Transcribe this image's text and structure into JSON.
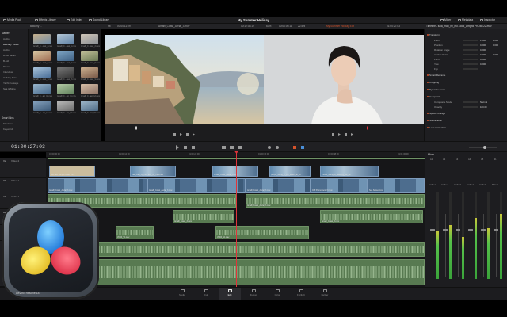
{
  "app": {
    "title": "My Summer Holiday",
    "brand": "DaVinci Resolve 18"
  },
  "topbar": {
    "left": [
      "Media Pool",
      "Effects Library",
      "Edit Index",
      "Sound Library"
    ],
    "right": [
      "Mixer",
      "Metadata",
      "Inspector"
    ]
  },
  "subbar": {
    "bin": "Balcony ...",
    "fit": "Fit",
    "tc_left": "00:00:11:09",
    "clip_name": "Amalfi_Coast_Aerial_3.mov",
    "tc_mid": "00:17:08:12",
    "zoom": "63%",
    "tc_mid2": "00:00:06:11",
    "pct": "22.5%",
    "timeline_name": "My Summer Holiday Edit",
    "tc_right": "01:00:27:03",
    "timeline_label": "Timeline - luka_mari_ny_mo...lock_Amgrid PROBE22.mov"
  },
  "left_panel": {
    "head": "Master",
    "items": [
      "Audio",
      "Balcony Views",
      "Audio",
      "B-roll Italian",
      "B-roll",
      "Drone",
      "Interview",
      "Holiday Raw",
      "Yacht Footage",
      "Sea & More"
    ],
    "smart_head": "Smart Bins",
    "smart_items": [
      "Timelines",
      "Keywords"
    ]
  },
  "media": {
    "thumbs": [
      {
        "label": "Amalfi_C...oast_3.mov",
        "c1": "#6d8aa6",
        "c2": "#c7b08b"
      },
      {
        "label": "Amalfi_C...oast_1.mov",
        "c1": "#5c7fa3",
        "c2": "#b4c7d6"
      },
      {
        "label": "Amalfi_C...oast_2.mov",
        "c1": "#8a8f94",
        "c2": "#d0c6b8"
      },
      {
        "label": "Amalfi_C...oast_4.mov",
        "c1": "#a06d52",
        "c2": "#d8c8a4"
      },
      {
        "label": "Amalfi_C...oast_5.mov",
        "c1": "#3e5f82",
        "c2": "#7fa6c6"
      },
      {
        "label": "Amalfi_C...oast_6.mov",
        "c1": "#6b7b55",
        "c2": "#c2c09a"
      },
      {
        "label": "Amalfi_C...oast_7.mov",
        "c1": "#4a6f99",
        "c2": "#a8c2d9"
      },
      {
        "label": "Amalfi_C...oast_8.mov",
        "c1": "#333",
        "c2": "#777"
      },
      {
        "label": "Amalfi_C...oast_9.mov",
        "c1": "#7a5a48",
        "c2": "#cbb08f"
      },
      {
        "label": "Amalfi_C...ast_10.mov",
        "c1": "#446688",
        "c2": "#99b6cc"
      },
      {
        "label": "Amalfi_C...ast_11.mov",
        "c1": "#5d7f5a",
        "c2": "#b5cba6"
      },
      {
        "label": "Amalfi_C...ast_12.mov",
        "c1": "#8a7064",
        "c2": "#d8c0a8"
      },
      {
        "label": "Amalfi_C...ast_13.mov",
        "c1": "#3d5a78",
        "c2": "#88a4bf"
      },
      {
        "label": "Amalfi_C...ast_14.mov",
        "c1": "#6a6a6a",
        "c2": "#bcbcbc"
      },
      {
        "label": "Amalfi_C...ast_15.mov",
        "c1": "#4e6b86",
        "c2": "#a0b8cb"
      },
      {
        "label": "Amalfi_C...ast_16.mov",
        "c1": "#7a6351",
        "c2": "#c9b194"
      }
    ]
  },
  "inspector": {
    "sections": [
      {
        "name": "Transform",
        "rows": [
          {
            "k": "Zoom",
            "v1": "1.000",
            "v2": "1.000"
          },
          {
            "k": "Position",
            "v1": "0.000",
            "v2": "0.000"
          },
          {
            "k": "Rotation Angle",
            "v1": "0.000",
            "v2": ""
          },
          {
            "k": "Anchor Point",
            "v1": "0.000",
            "v2": "0.000"
          },
          {
            "k": "Pitch",
            "v1": "0.000",
            "v2": ""
          },
          {
            "k": "Yaw",
            "v1": "0.000",
            "v2": ""
          },
          {
            "k": "Flip",
            "v1": "",
            "v2": ""
          }
        ]
      },
      {
        "name": "Smart Reframe",
        "rows": []
      },
      {
        "name": "Cropping",
        "rows": []
      },
      {
        "name": "Dynamic Zoom",
        "rows": []
      },
      {
        "name": "Composite",
        "rows": [
          {
            "k": "Composite Mode",
            "v1": "Normal",
            "v2": ""
          },
          {
            "k": "Opacity",
            "v1": "100.00",
            "v2": ""
          }
        ]
      },
      {
        "name": "Speed Change",
        "rows": []
      },
      {
        "name": "Stabilization",
        "rows": []
      },
      {
        "name": "Lens Correction",
        "rows": []
      }
    ]
  },
  "timeline": {
    "timecode": "01:00:27:03",
    "ruler": [
      "01:00:00:00",
      "01:00:12:00",
      "01:00:24:00",
      "01:00:36:00",
      "01:00:48:00",
      "01:01:00:00"
    ],
    "tracks": [
      {
        "id": "V2",
        "name": "Video 2"
      },
      {
        "id": "V1",
        "name": "Video 1"
      },
      {
        "id": "A1",
        "name": "Audio 1"
      },
      {
        "id": "A2",
        "name": "Audio 2"
      },
      {
        "id": "A3",
        "name": "Audio 3"
      },
      {
        "id": "A4",
        "name": "Audio 4"
      },
      {
        "id": "A5",
        "name": "Audio 5"
      }
    ],
    "v2_clips": [
      {
        "label": "Mid-Text Simple Lower Third",
        "type": "title"
      },
      {
        "label": "luka_mari_ny_mo...lock_on_mov.mov",
        "type": "v"
      },
      {
        "label": "Amalfi_Coast_Aerial_3.mov",
        "type": "v"
      },
      {
        "label": "people_sitting_in_the_beach_at_su",
        "type": "v"
      },
      {
        "label": "friends_sitting_a_table_by_the_ca",
        "type": "v"
      }
    ],
    "v1_clips": [
      {
        "label": "Amalfi_Coast_Aerial_3.mov"
      },
      {
        "label": "Amalfi_Coast_Aerial_3.mov"
      },
      {
        "label": "Amalfi_Coast_Aerial_3.mov"
      },
      {
        "label": "Cliff Promo Aerial 3.mov"
      },
      {
        "label": "Sea Sunset.mov"
      }
    ],
    "audio_labels": [
      "Amalfi_Coast_Aerial_3.mov",
      "Amalfi_Coast_3.mov",
      "VO04_V1.wav",
      "Wind_Soundscape",
      "SFX_Bird_Whistle",
      "Beach Sound for Timeline.mov"
    ]
  },
  "mixer": {
    "title": "Mixer",
    "channels": [
      "A1",
      "A2",
      "A3",
      "A4",
      "A5",
      "M1"
    ],
    "channel_labels": [
      "Audio 1",
      "Audio 2",
      "Audio 3",
      "Audio 4",
      "Audio 5",
      "Main 1"
    ],
    "levels": [
      0.55,
      0.62,
      0.48,
      0.7,
      0.58,
      0.75
    ]
  },
  "pages": [
    {
      "label": "Media",
      "active": false
    },
    {
      "label": "Cut",
      "active": false
    },
    {
      "label": "Edit",
      "active": true
    },
    {
      "label": "Fusion",
      "active": false
    },
    {
      "label": "Color",
      "active": false
    },
    {
      "label": "Fairlight",
      "active": false
    },
    {
      "label": "Deliver",
      "active": false
    }
  ],
  "colors": {
    "playhead": "#e0343a",
    "video_clip": "#4d6d8e",
    "audio_clip": "#587a51",
    "accent": "#d4532b"
  }
}
